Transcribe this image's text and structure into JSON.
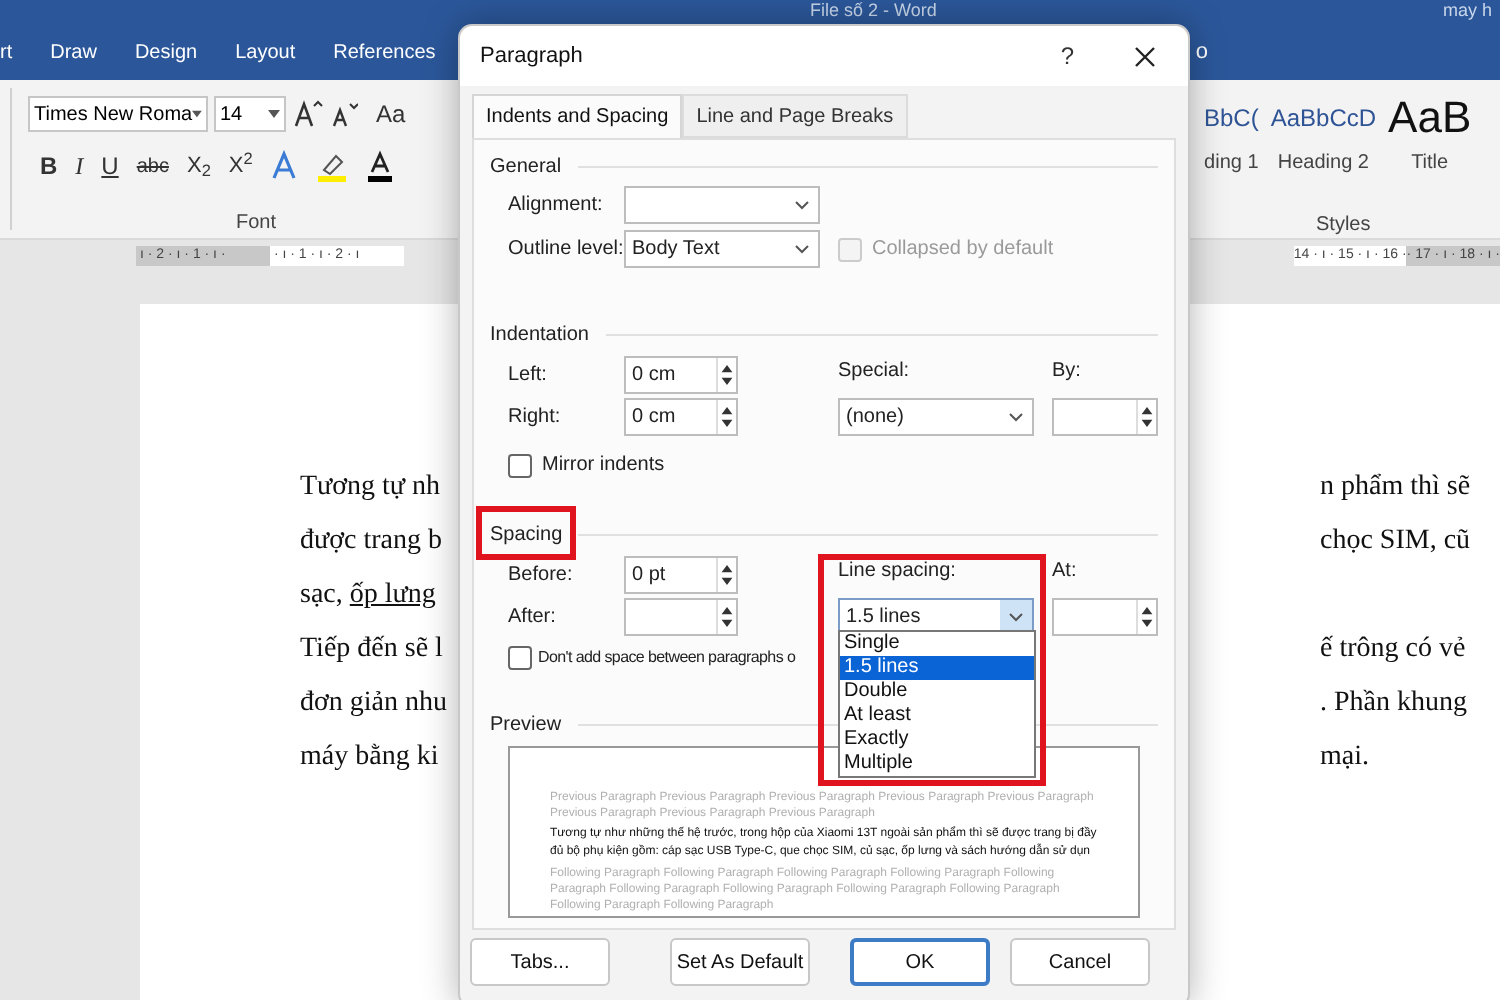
{
  "window": {
    "title": "File số 2  -  Word",
    "user": "may h"
  },
  "ribbon_tabs": [
    {
      "label": "rt"
    },
    {
      "label": "Draw"
    },
    {
      "label": "Design"
    },
    {
      "label": "Layout"
    },
    {
      "label": "References"
    }
  ],
  "ribbon_tab_fragment": "o",
  "font_group": {
    "font_name": "Times New Roma",
    "font_size": "14",
    "case_button": "Aa",
    "format_buttons": [
      {
        "kind": "bold",
        "label": "B"
      },
      {
        "kind": "italic",
        "label": "I"
      },
      {
        "kind": "underline",
        "label": "U"
      },
      {
        "kind": "strike",
        "label": "abc"
      },
      {
        "kind": "sub",
        "label": "X$_{2}$"
      },
      {
        "kind": "sup",
        "label": "X$^{2}$"
      }
    ],
    "label": "Font"
  },
  "styles_group": {
    "styles": [
      {
        "preview": "BbC(",
        "name": "ding 1",
        "kind": "heading"
      },
      {
        "preview": "AaBbCcD",
        "name": "Heading 2",
        "kind": "heading"
      },
      {
        "preview": "AaB",
        "name": "Title",
        "kind": "title"
      }
    ],
    "label": "Styles"
  },
  "ruler": {
    "left": "ı · 2 · ı · 1 · ı ·",
    "middle": "· ı · 1 · ı · 2 · ı",
    "right": "14 · ı · 15 · ı · 16 ·",
    "right_grey": "· 17 · ı · 18 · ı ·"
  },
  "document": {
    "lines": [
      {
        "left": "Tương tự nh",
        "right": "n phẩm thì sẽ"
      },
      {
        "left": "được trang b",
        "right": "chọc SIM, cũ"
      },
      {
        "left": "sạc,",
        "left_underlined": "ốp lưng"
      },
      {
        "left": "Tiếp đến sẽ l",
        "right": "ế trông có vẻ"
      },
      {
        "left": "đơn giản nhu",
        "right": ". Phần khung"
      },
      {
        "left": "máy bằng ki",
        "right": "mại."
      }
    ]
  },
  "dialog": {
    "title": "Paragraph",
    "help": "?",
    "tabs": [
      {
        "label": "Indents and Spacing",
        "selected": true
      },
      {
        "label": "Line and Page Breaks",
        "selected": false
      }
    ],
    "general": {
      "heading": "General",
      "alignment_label": "Alignment:",
      "outline_label": "Outline level:",
      "outline_value": "Body Text",
      "collapsed": {
        "label": "Collapsed by default",
        "checked": false,
        "disabled": true
      }
    },
    "indentation": {
      "heading": "Indentation",
      "left_label": "Left:",
      "left_value": "0 cm",
      "right_label": "Right:",
      "right_value": "0 cm",
      "special_label": "Special:",
      "special_value": "(none)",
      "by_label": "By:",
      "mirror": {
        "label": "Mirror indents",
        "checked": false
      }
    },
    "spacing": {
      "heading": "Spacing",
      "before_label": "Before:",
      "before_value": "0 pt",
      "after_label": "After:",
      "line_spacing_label": "Line spacing:",
      "line_spacing_value": "1.5 lines",
      "at_label": "At:",
      "dont_add": {
        "label": "Don't add space between paragraphs o",
        "checked": false
      },
      "options": [
        {
          "label": "Single",
          "selected": false
        },
        {
          "label": "1.5 lines",
          "selected": true
        },
        {
          "label": "Double",
          "selected": false
        },
        {
          "label": "At least",
          "selected": false
        },
        {
          "label": "Exactly",
          "selected": false
        },
        {
          "label": "Multiple",
          "selected": false
        }
      ]
    },
    "preview": {
      "heading": "Preview",
      "previous": "Previous Paragraph Previous Paragraph Previous Paragraph Previous Paragraph Previous Paragraph Previous Paragraph Previous Paragraph Previous Paragraph",
      "sample": "Tương tự như những thế hệ trước, trong hộp của Xiaomi 13T ngoài sản phẩm thì sẽ được trang bị đầy đủ bộ phụ kiện gồm: cáp sạc USB Type-C, que chọc SIM, củ sạc, ốp lưng và sách hướng dẫn sử dụn",
      "following": "Following Paragraph Following Paragraph Following Paragraph Following Paragraph Following Paragraph Following Paragraph Following Paragraph Following Paragraph Following Paragraph Following Paragraph Following Paragraph"
    },
    "buttons": [
      {
        "label": "Tabs...",
        "kind": "normal"
      },
      {
        "label": "Set As Default",
        "kind": "normal"
      },
      {
        "label": "OK",
        "kind": "default"
      },
      {
        "label": "Cancel",
        "kind": "normal"
      }
    ]
  }
}
